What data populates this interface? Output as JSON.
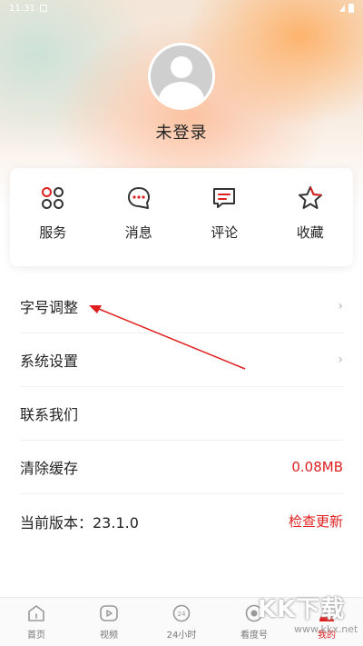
{
  "status_bar": {
    "time": "11:31"
  },
  "profile": {
    "login_text": "未登录"
  },
  "quick_actions": [
    {
      "label": "服务",
      "icon": "service-icon"
    },
    {
      "label": "消息",
      "icon": "message-icon"
    },
    {
      "label": "评论",
      "icon": "comment-icon"
    },
    {
      "label": "收藏",
      "icon": "favorite-star-icon"
    }
  ],
  "menu": {
    "font_size": "字号调整",
    "settings": "系统设置",
    "contact": "联系我们",
    "clear_cache": "清除缓存",
    "cache_size": "0.08MB",
    "version_label": "当前版本：23.1.0",
    "check_update": "检查更新"
  },
  "tabbar": [
    {
      "label": "首页",
      "icon": "home-icon"
    },
    {
      "label": "视频",
      "icon": "video-play-icon"
    },
    {
      "label": "24小时",
      "icon": "clock-24-icon"
    },
    {
      "label": "看度号",
      "icon": "kandu-icon"
    },
    {
      "label": "我的",
      "icon": "profile-icon",
      "active": true
    }
  ],
  "watermark": {
    "big": "KK下载",
    "small": "www.kkx.net"
  },
  "colors": {
    "accent": "#e02020",
    "icon_dark": "#333333",
    "icon_red": "#e02020"
  }
}
